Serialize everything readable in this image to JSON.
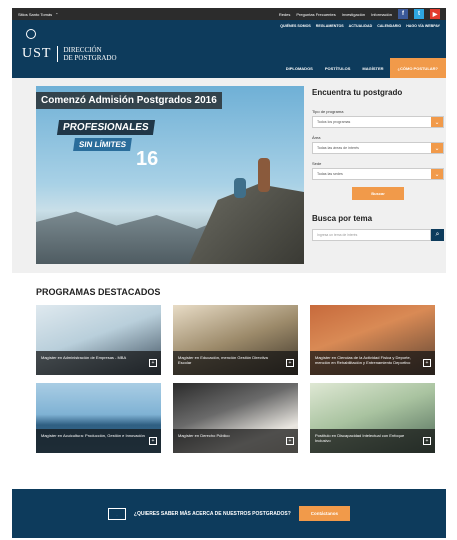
{
  "topbar": {
    "sede_label": "Sitios Santo Tomás",
    "links": [
      "Redes",
      "Preguntas Frecuentes",
      "Investigación",
      "Información"
    ],
    "social": [
      "facebook-icon",
      "twitter-icon",
      "youtube-icon"
    ]
  },
  "header": {
    "logo_text": "UST",
    "brand_line1": "DIRECCIÓN",
    "brand_line2": "DE POSTGRADO",
    "nav_top": [
      "QUIÉNES SOMOS",
      "REGLAMENTOS",
      "ACTUALIDAD",
      "CALENDARIO",
      "HAGO VÍA WEBPAY"
    ],
    "nav_main": [
      "DIPLOMADOS",
      "POSTÍTULOS",
      "MAGÍSTER"
    ],
    "nav_cta": "¿CÓMO POSTULAR?"
  },
  "hero": {
    "title": "Comenzó Admisión Postgrados 2016",
    "tag1": "PROFESIONALES",
    "tag2": "SIN LÍMITES",
    "year": "16"
  },
  "search": {
    "heading": "Encuentra tu postgrado",
    "programa_label": "Tipo de programa",
    "programa_value": "Todos los programas",
    "area_label": "Área",
    "area_value": "Todas las áreas de interés",
    "sede_label": "Sede",
    "sede_value": "Todas las sedes",
    "button": "Buscar",
    "tema_heading": "Busca por tema",
    "tema_placeholder": "Ingresa un tema de interés"
  },
  "programs": {
    "heading": "PROGRAMAS DESTACADOS",
    "items": [
      {
        "label": "Magíster en Administración de Empresas - MBA"
      },
      {
        "label": "Magíster en Educación, mención Gestión Directiva Escolar"
      },
      {
        "label": "Magíster en Ciencias de la Actividad Física y Deporte, mención en Rehabilitación y Entrenamiento Deportivo"
      },
      {
        "label": "Magíster en Acuicultura: Producción, Gestión e Innovación"
      },
      {
        "label": "Magíster en Derecho Público"
      },
      {
        "label": "Postítulo en Discapacidad Intelectual con Enfoque Inclusivo"
      }
    ],
    "plus": "[+]"
  },
  "footer": {
    "question": "¿QUIERES SABER MÁS ACERCA DE NUESTROS POSTGRADOS?",
    "button": "Contáctanos"
  },
  "colors": {
    "navy": "#0d3b5c",
    "orange": "#f19a4a",
    "facebook": "#3b5998",
    "twitter": "#2ea6e0",
    "youtube": "#e23b2e"
  }
}
